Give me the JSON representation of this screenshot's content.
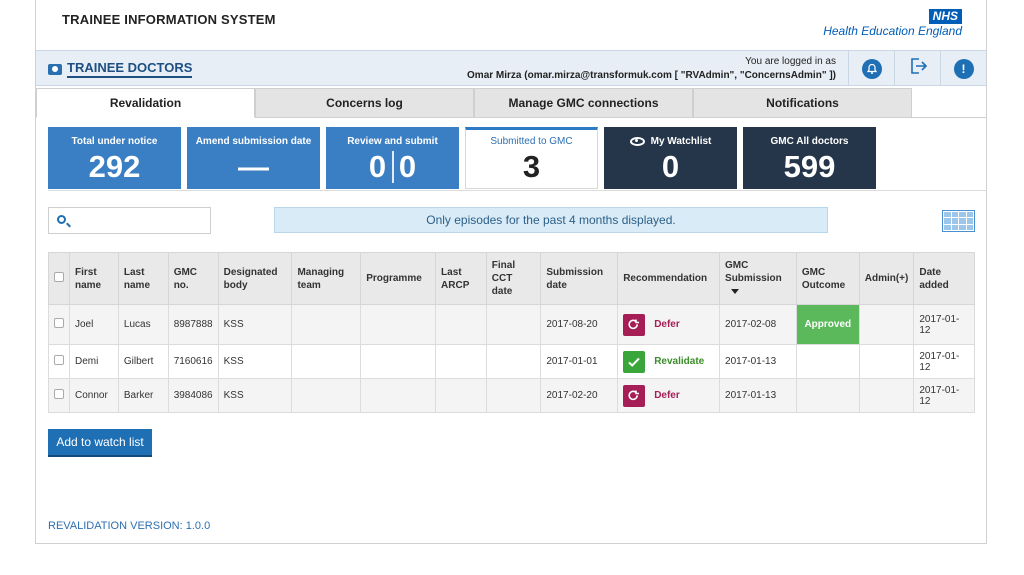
{
  "header": {
    "system_title": "TRAINEE INFORMATION SYSTEM",
    "nhs_logo": "NHS",
    "org_name": "Health Education England"
  },
  "topbar": {
    "app_title": "TRAINEE DOCTORS",
    "logged_in_label": "You are logged in as",
    "user": "Omar Mirza (omar.mirza@transformuk.com [ \"RVAdmin\", \"ConcernsAdmin\" ])",
    "icons": [
      "bell-icon",
      "logout-icon",
      "info-icon"
    ],
    "info_glyph": "!"
  },
  "tabs": [
    {
      "label": "Revalidation",
      "active": true
    },
    {
      "label": "Concerns log",
      "active": false
    },
    {
      "label": "Manage GMC connections",
      "active": false
    },
    {
      "label": "Notifications",
      "active": false
    }
  ],
  "cards": {
    "total_under_notice": {
      "title": "Total under notice",
      "value": "292"
    },
    "amend_submission": {
      "title": "Amend submission date",
      "value": "—"
    },
    "review_submit": {
      "title": "Review and submit",
      "value_left": "0",
      "value_right": "0"
    },
    "submitted_gmc": {
      "title": "Submitted to GMC",
      "value": "3"
    },
    "watchlist": {
      "title": "My Watchlist",
      "value": "0"
    },
    "gmc_all": {
      "title": "GMC All doctors",
      "value": "599"
    }
  },
  "notice": "Only episodes for the past 4 months displayed.",
  "table": {
    "headers": [
      "",
      "First name",
      "Last name",
      "GMC no.",
      "Designated body",
      "Managing team",
      "Programme",
      "Last ARCP",
      "Final CCT date",
      "Submission date",
      "Recommendation",
      "GMC Submission",
      "GMC Outcome",
      "Admin(+)",
      "Date added"
    ],
    "rows": [
      {
        "first": "Joel",
        "last": "Lucas",
        "gmc": "8987888",
        "body": "KSS",
        "team": "",
        "programme": "",
        "arcp": "",
        "cct": "",
        "submission": "2017-08-20",
        "recommendation": "Defer",
        "gmc_submission": "2017-02-08",
        "outcome": "Approved",
        "admin": "",
        "added": "2017-01-12"
      },
      {
        "first": "Demi",
        "last": "Gilbert",
        "gmc": "7160616",
        "body": "KSS",
        "team": "",
        "programme": "",
        "arcp": "",
        "cct": "",
        "submission": "2017-01-01",
        "recommendation": "Revalidate",
        "gmc_submission": "2017-01-13",
        "outcome": "",
        "admin": "",
        "added": "2017-01-12"
      },
      {
        "first": "Connor",
        "last": "Barker",
        "gmc": "3984086",
        "body": "KSS",
        "team": "",
        "programme": "",
        "arcp": "",
        "cct": "",
        "submission": "2017-02-20",
        "recommendation": "Defer",
        "gmc_submission": "2017-01-13",
        "outcome": "",
        "admin": "",
        "added": "2017-01-12"
      }
    ]
  },
  "actions": {
    "add_watch": "Add to watch list"
  },
  "footer": {
    "version": "REVALIDATION VERSION: 1.0.0"
  },
  "colors": {
    "primary": "#1f6fb5",
    "dark_card": "#25364a",
    "defer": "#a51e55",
    "revalidate": "#3aa53a",
    "approved": "#5bb85b"
  }
}
